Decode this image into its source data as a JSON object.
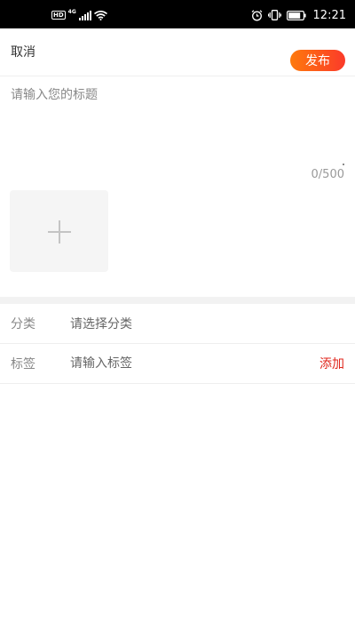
{
  "status_bar": {
    "hd_label": "HD",
    "network_label": "4G",
    "time": "12:21",
    "icons": [
      "hd-icon",
      "signal-icon",
      "wifi-icon",
      "alarm-icon",
      "vibrate-icon",
      "battery-icon"
    ]
  },
  "header": {
    "cancel_label": "取消",
    "publish_label": "发布",
    "publish_gradient": [
      "#fe7a0c",
      "#fb3a2a"
    ]
  },
  "title_input": {
    "placeholder": "请输入您的标题",
    "value": "",
    "char_count": "0/500"
  },
  "image_upload": {
    "icon": "plus-icon"
  },
  "form": {
    "category": {
      "label": "分类",
      "placeholder": "请选择分类"
    },
    "tags": {
      "label": "标签",
      "placeholder": "请输入标签",
      "add_label": "添加",
      "add_color": "#e0261c"
    }
  }
}
